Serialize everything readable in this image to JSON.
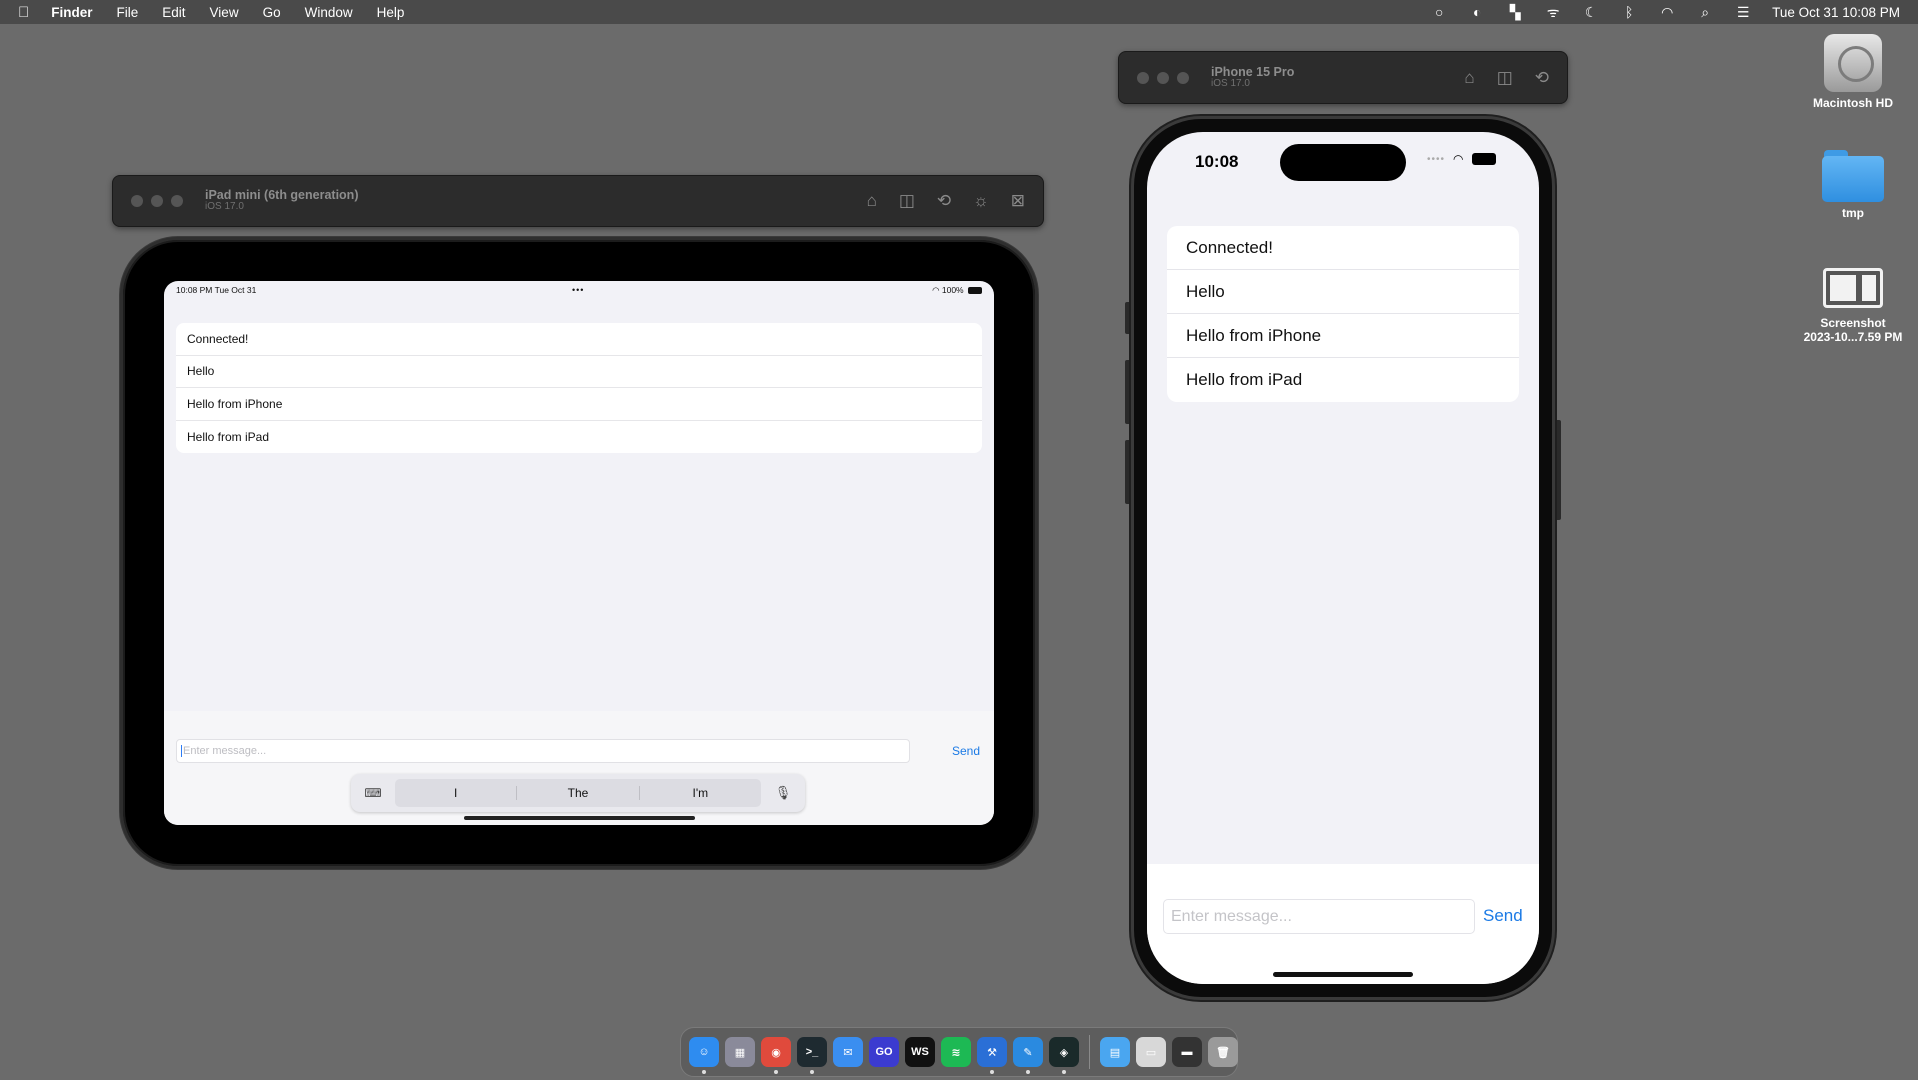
{
  "menubar": {
    "apple_icon": "apple-logo-icon",
    "app_name": "Finder",
    "menus": [
      "File",
      "Edit",
      "View",
      "Go",
      "Window",
      "Help"
    ],
    "status_icons": [
      "screen-record-icon",
      "contrast-icon",
      "stage-manager-icon",
      "airdrop-icon",
      "focus-moon-icon",
      "bluetooth-icon",
      "wifi-icon",
      "search-icon",
      "control-center-icon"
    ],
    "clock": "Tue Oct 31  10:08 PM"
  },
  "desktop": {
    "icons": [
      {
        "label": "Macintosh HD",
        "icon": "hard-drive-icon"
      },
      {
        "label": "tmp",
        "icon": "folder-icon"
      },
      {
        "label_line1": "Screenshot",
        "label_line2": "2023-10...7.59 PM",
        "icon": "screenshot-file-icon"
      }
    ]
  },
  "ipad_sim": {
    "title": "iPad mini (6th generation)",
    "os": "iOS 17.0",
    "toolbar_icons": [
      "home-icon",
      "screenshot-icon",
      "rotate-icon",
      "appearance-icon",
      "close-box-icon"
    ],
    "status_time": "10:08 PM   Tue Oct 31",
    "status_dots": "•••",
    "status_right": "100%",
    "messages": [
      "Connected!",
      "Hello",
      "Hello from iPhone",
      "Hello from iPad"
    ],
    "input_placeholder": "Enter message...",
    "send_label": "Send",
    "suggestions": [
      "I",
      "The",
      "I'm"
    ]
  },
  "iphone_sim": {
    "title": "iPhone 15 Pro",
    "os": "iOS 17.0",
    "toolbar_icons": [
      "home-icon",
      "screenshot-icon",
      "rotate-icon"
    ],
    "status_time": "10:08",
    "messages": [
      "Connected!",
      "Hello",
      "Hello from iPhone",
      "Hello from iPad"
    ],
    "input_placeholder": "Enter message...",
    "send_label": "Send"
  },
  "dock": {
    "apps": [
      {
        "name": "finder-icon",
        "color": "#2e8cf0",
        "glyph": "☺",
        "running": true
      },
      {
        "name": "launchpad-icon",
        "color": "#8a8a9a",
        "glyph": "▦",
        "running": false
      },
      {
        "name": "chrome-icon",
        "color": "#e04a3c",
        "glyph": "◉",
        "running": true
      },
      {
        "name": "terminal-icon",
        "color": "#1e2a30",
        "glyph": ">_",
        "running": true
      },
      {
        "name": "mail-icon",
        "color": "#3a8ef0",
        "glyph": "✉",
        "running": false
      },
      {
        "name": "goland-icon",
        "color": "#3b3bd0",
        "glyph": "GO",
        "running": false
      },
      {
        "name": "webstorm-icon",
        "color": "#111",
        "glyph": "WS",
        "running": false
      },
      {
        "name": "spotify-icon",
        "color": "#1db954",
        "glyph": "≋",
        "running": false
      },
      {
        "name": "xcode-icon",
        "color": "#2a6fd6",
        "glyph": "⚒",
        "running": true
      },
      {
        "name": "simulator-icon",
        "color": "#2a8ae0",
        "glyph": "✎",
        "running": true
      },
      {
        "name": "app-icon",
        "color": "#1a2a2a",
        "glyph": "◈",
        "running": true
      },
      {
        "name": "downloads-folder-icon",
        "color": "#4aa6f0",
        "glyph": "▤",
        "running": false
      },
      {
        "name": "documents-stack-icon",
        "color": "#d8d8d8",
        "glyph": "▭",
        "running": false
      },
      {
        "name": "screenshots-stack-icon",
        "color": "#333",
        "glyph": "▬",
        "running": false
      },
      {
        "name": "trash-icon",
        "color": "#9a9a9a",
        "glyph": "🗑",
        "running": false
      }
    ]
  }
}
